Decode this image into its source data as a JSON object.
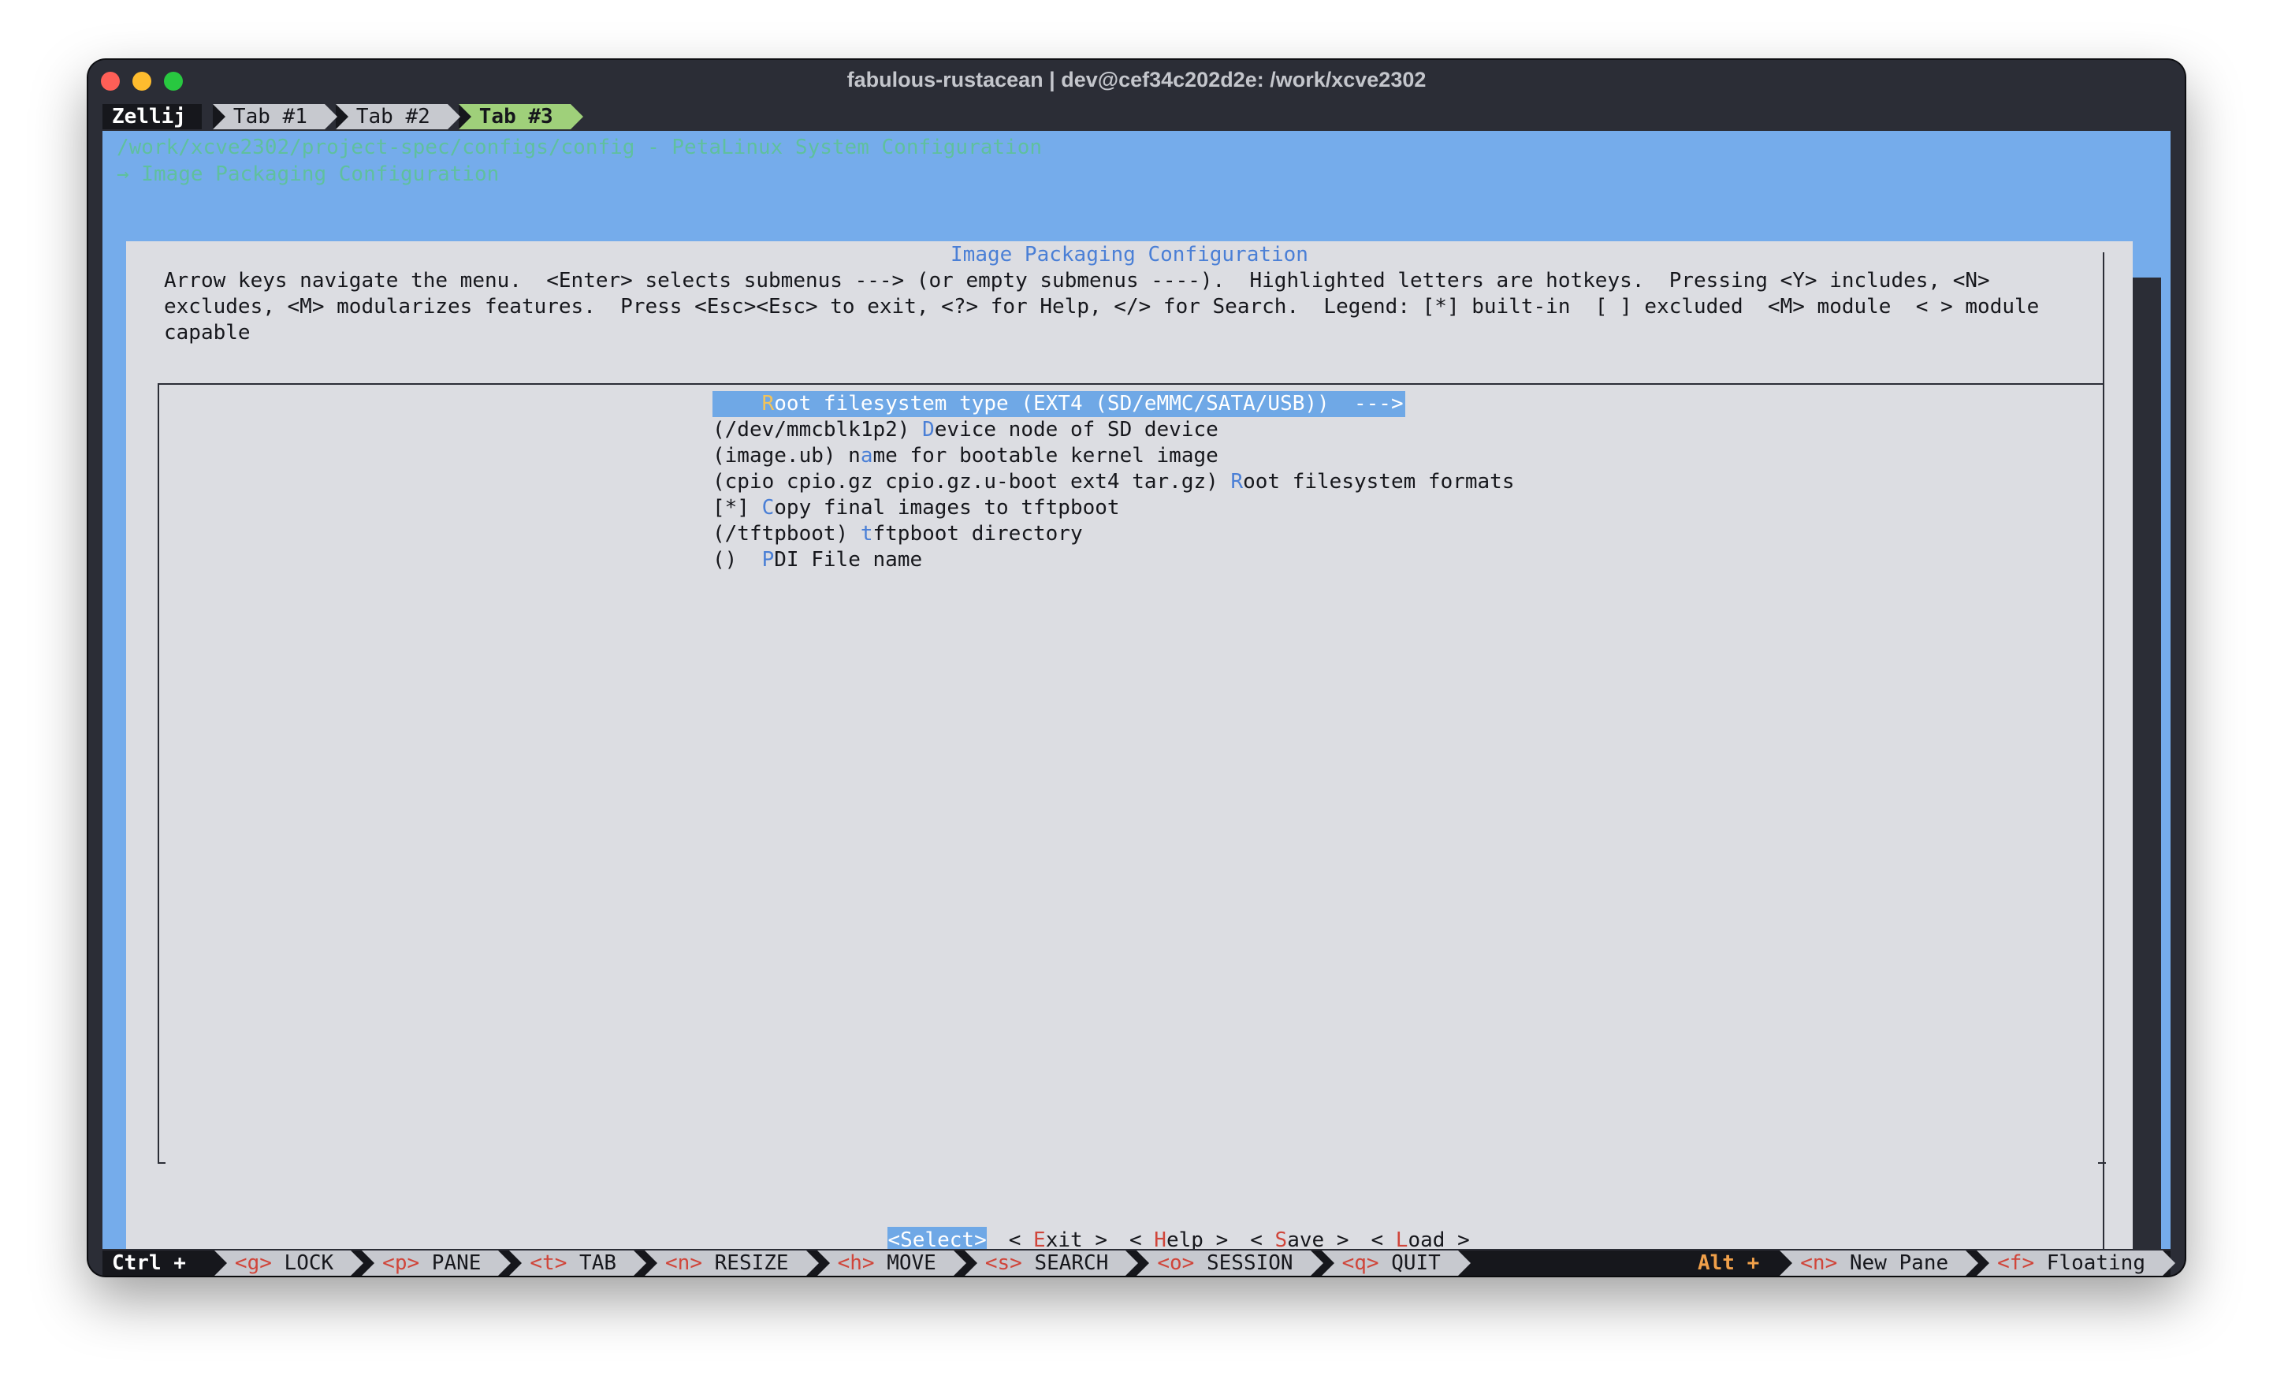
{
  "window": {
    "title": "fabulous-rustacean | dev@cef34c202d2e: /work/xcve2302"
  },
  "tabbar": {
    "mode": "Zellij",
    "tabs": [
      {
        "label": "Tab #1",
        "active": false
      },
      {
        "label": "Tab #2",
        "active": false
      },
      {
        "label": "Tab #3",
        "active": true
      }
    ]
  },
  "breadcrumb": {
    "line1": "/work/xcve2302/project-spec/configs/config - PetaLinux System Configuration",
    "line2": "→ Image Packaging Configuration"
  },
  "dialog": {
    "title": "Image Packaging Configuration",
    "help_text": "Arrow keys navigate the menu.  <Enter> selects submenus ---> (or empty submenus ----).  Highlighted letters are hotkeys.  Pressing <Y> includes, <N>\nexcludes, <M> modularizes features.  Press <Esc><Esc> to exit, <?> for Help, </> for Search.  Legend: [*] built-in  [ ] excluded  <M> module  < > module\ncapable",
    "items": [
      {
        "prefix": "    ",
        "hotkey": "R",
        "rest": "oot filesystem type (EXT4 (SD/eMMC/SATA/USB))  --->",
        "selected": true
      },
      {
        "prefix": "(/dev/mmcblk1p2) ",
        "hotkey": "D",
        "rest": "evice node of SD device",
        "selected": false
      },
      {
        "prefix": "(image.ub) n",
        "hotkey": "a",
        "rest": "me for bootable kernel image",
        "selected": false
      },
      {
        "prefix": "(cpio cpio.gz cpio.gz.u-boot ext4 tar.gz) ",
        "hotkey": "R",
        "rest": "oot filesystem formats",
        "selected": false
      },
      {
        "prefix": "[*] ",
        "hotkey": "C",
        "rest": "opy final images to tftpboot",
        "selected": false
      },
      {
        "prefix": "(/tftpboot) ",
        "hotkey": "t",
        "rest": "ftpboot directory",
        "selected": false
      },
      {
        "prefix": "()  ",
        "hotkey": "P",
        "rest": "DI File name",
        "selected": false
      }
    ],
    "buttons": [
      {
        "open": "<",
        "hotkey": "S",
        "rest": "elect",
        "close": ">",
        "selected": true
      },
      {
        "open": "< ",
        "hotkey": "E",
        "rest": "xit",
        "close": " >",
        "selected": false
      },
      {
        "open": "< ",
        "hotkey": "H",
        "rest": "elp",
        "close": " >",
        "selected": false
      },
      {
        "open": "< ",
        "hotkey": "S",
        "rest": "ave",
        "close": " >",
        "selected": false
      },
      {
        "open": "< ",
        "hotkey": "L",
        "rest": "oad",
        "close": " >",
        "selected": false
      }
    ]
  },
  "statusbar": {
    "mode": "Ctrl +",
    "keys": [
      {
        "key": "<g>",
        "label": "LOCK"
      },
      {
        "key": "<p>",
        "label": "PANE"
      },
      {
        "key": "<t>",
        "label": "TAB"
      },
      {
        "key": "<n>",
        "label": "RESIZE"
      },
      {
        "key": "<h>",
        "label": "MOVE"
      },
      {
        "key": "<s>",
        "label": "SEARCH"
      },
      {
        "key": "<o>",
        "label": "SESSION"
      },
      {
        "key": "<q>",
        "label": "QUIT"
      }
    ],
    "alt_mode": "Alt +",
    "alt_keys": [
      {
        "key": "<n>",
        "label": "New Pane"
      },
      {
        "key": "<f>",
        "label": "Floating"
      }
    ]
  },
  "colors": {
    "terminal_bg": "#75aceb",
    "dialog_bg": "#dcdde2",
    "hotkey_blue": "#4a7fd6",
    "selection": "#6fa8e6",
    "active_tab": "#9fd07a"
  }
}
